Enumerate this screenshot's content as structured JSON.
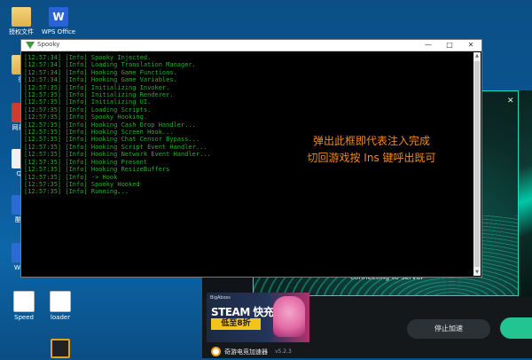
{
  "desktop": {
    "icons": [
      {
        "label": "授权文件",
        "icon": "folder-icon"
      },
      {
        "label": "WPS Office",
        "icon": "wps-icon"
      },
      {
        "label": "征",
        "icon": "folder-icon"
      },
      {
        "label": "网易云",
        "icon": "app-icon"
      },
      {
        "label": "QQ",
        "icon": "qq-icon"
      },
      {
        "label": "酷狗",
        "icon": "app-icon"
      },
      {
        "label": "WeG",
        "icon": "app-icon"
      },
      {
        "label": "Speed",
        "icon": "file-icon"
      },
      {
        "label": "loader",
        "icon": "file-icon"
      }
    ]
  },
  "spooky": {
    "title": "Spooky",
    "minimize": "—",
    "maximize": "□",
    "close": "✕",
    "log": [
      "[12:57:34] [Info] Spooky Injected.",
      "[12:57:34] [Info] Loading Translation Manager.",
      "[12:57:34] [Info] Hooking Game Functions.",
      "[12:57:34] [Info] Hooking Game Variables.",
      "[12:57:35] [Info] Initializing Invoker.",
      "[12:57:35] [Info] Initializing Renderer.",
      "[12:57:35] [Info] Initializing UI.",
      "[12:57:35] [Info] Loading Scripts.",
      "[12:57:35] [Info] Spooky Hooking.",
      "[12:57:35] [Info] Hooking Cash Drop Handler...",
      "[12:57:35] [Info] Hooking Screen Hook...",
      "[12:57:35] [Info] Hooking Chat Censor Bypass...",
      "[12:57:35] [Info] Hooking Script Event Handler...",
      "[12:57:35] [Info] Hooking Network Event Handler...",
      "[12:57:35] [Info] Hooking Present",
      "[12:57:35] [Info] Hooking ResizeBuffers",
      "[12:57:35] [Info] -> Hook",
      "[12:57:35] [Info] Spooky Hooked",
      "[12:57:35] [Info] Running..."
    ],
    "notice_line1": "弹出此框即代表注入完成",
    "notice_line2": "切回游戏按 Ins 键呼出既可"
  },
  "launcher": {
    "status": "connecting to server",
    "close": "✕",
    "ad_tag": "BigAboss",
    "ad_title": "STEAM 快充",
    "ad_price": "低至8折",
    "brand": "奇游电竞加速器",
    "version": "v5.2.3",
    "stop_label": "停止加速"
  }
}
